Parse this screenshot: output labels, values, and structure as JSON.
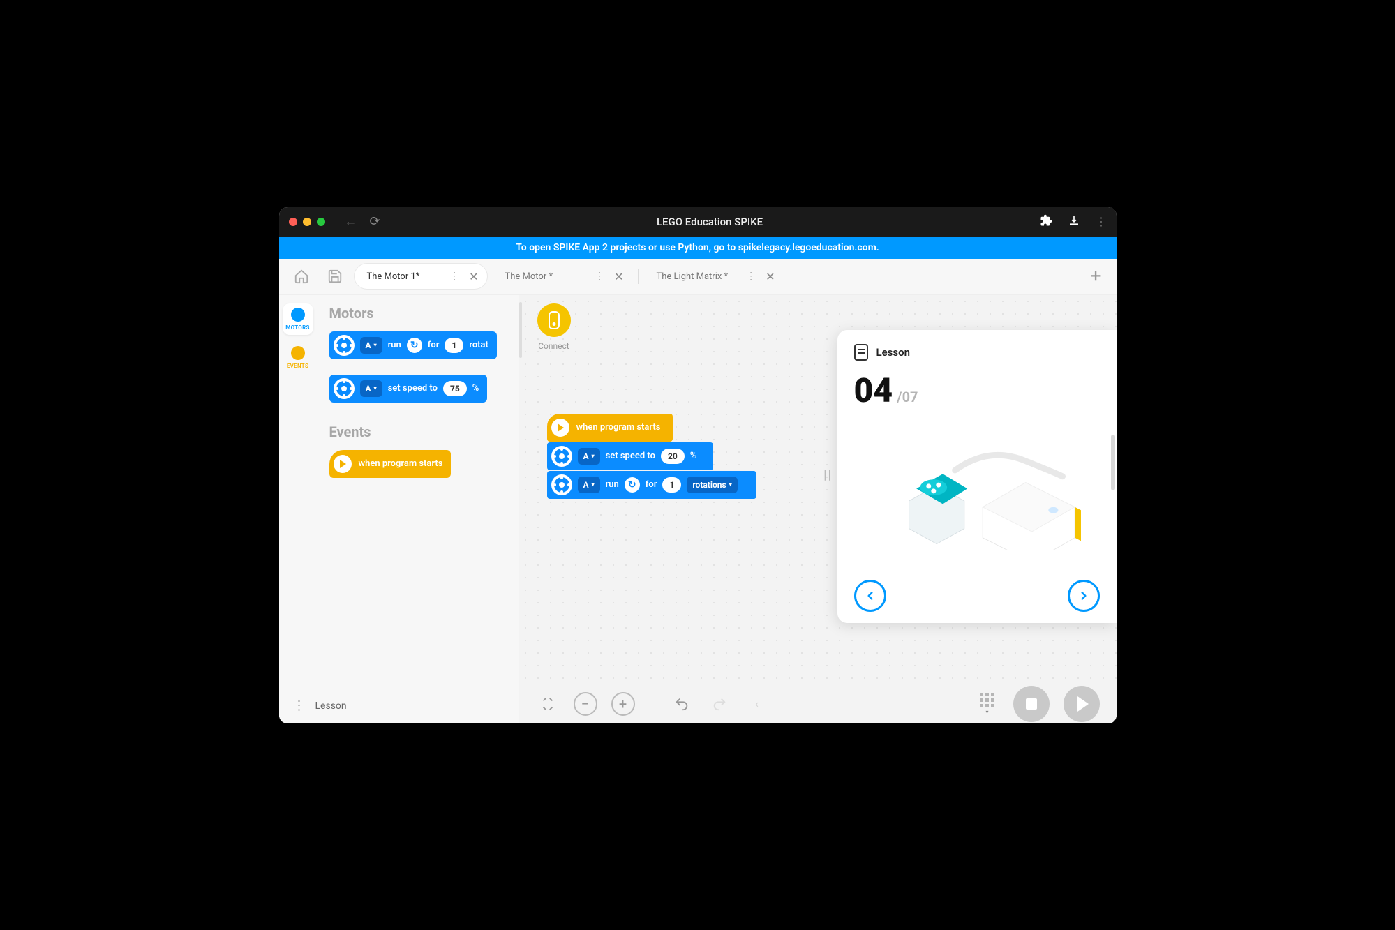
{
  "window": {
    "title": "LEGO Education SPIKE"
  },
  "banner": {
    "text": "To open SPIKE App 2 projects or use Python, go to spikelegacy.legoeducation.com."
  },
  "tabs": [
    {
      "title": "The Motor 1*",
      "active": true
    },
    {
      "title": "The Motor *",
      "active": false
    },
    {
      "title": "The Light Matrix *",
      "active": false
    }
  ],
  "leftnav": [
    {
      "id": "motors",
      "label": "MOTORS",
      "color": "blue",
      "active": true
    },
    {
      "id": "events",
      "label": "EVENTS",
      "color": "yellow",
      "active": false
    }
  ],
  "palette": {
    "sections": [
      {
        "title": "Motors",
        "blocks": [
          {
            "type": "motor-run",
            "port": "A",
            "direction": "cw",
            "for_word": "for",
            "amount": "1",
            "unit_partial": "rotat"
          },
          {
            "type": "motor-speed",
            "port": "A",
            "label": "set speed to",
            "value": "75",
            "suffix": "%"
          }
        ]
      },
      {
        "title": "Events",
        "blocks": [
          {
            "type": "program-start",
            "label": "when program starts"
          }
        ]
      }
    ]
  },
  "connect": {
    "label": "Connect"
  },
  "canvas_stack": {
    "blocks": [
      {
        "type": "program-start",
        "label": "when program starts"
      },
      {
        "type": "motor-speed",
        "port": "A",
        "label": "set speed to",
        "value": "20",
        "suffix": "%"
      },
      {
        "type": "motor-run",
        "port": "A",
        "run_word": "run",
        "direction": "cw",
        "for_word": "for",
        "amount": "1",
        "unit": "rotations"
      }
    ]
  },
  "lesson": {
    "heading": "Lesson",
    "step_current": "04",
    "step_total": "/07"
  },
  "bottom": {
    "lesson_label": "Lesson"
  }
}
